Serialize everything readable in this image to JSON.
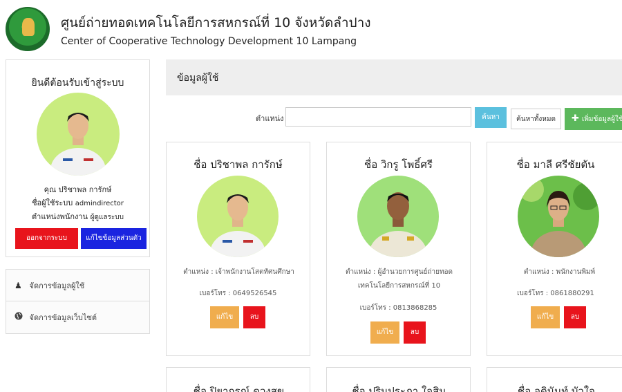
{
  "header": {
    "title_th": "ศูนย์ถ่ายทอดเทคโนโลยีการสหกรณ์ที่ 10 จังหวัดลำปาง",
    "title_en": "Center of Cooperative Technology Development 10 Lampang"
  },
  "profile": {
    "welcome": "ยินดีต้อนรับเข้าสู่ระบบ",
    "name_line": "คุณ ปริชาพล การักษ์",
    "username_label": "ชื่อผู้ใช้ระบบ",
    "username": "admindirector",
    "position_label": "ตำแหน่งพนักงาน",
    "position": "ผู้ดูแลระบบ",
    "logout_label": "ออกจากระบบ",
    "edit_self_label": "แก้ไขข้อมูลส่วนตัว"
  },
  "menu": {
    "items": [
      {
        "label": "จัดการข้อมูลผู้ใช้",
        "icon": "user-icon"
      },
      {
        "label": "จัดการข้อมูลเว็บไซต์",
        "icon": "globe-icon"
      }
    ]
  },
  "main": {
    "panel_title": "ข้อมูลผู้ใช้",
    "search_label": "ตำแหน่ง",
    "search_value": "",
    "search_button": "ค้นหา",
    "search_all_button": "ค้นหาทั้งหมด",
    "add_button": "เพิ่มข้อมูลผู้ใช้"
  },
  "users": [
    {
      "name": "ชื่อ ปริชาพล การักษ์",
      "position_line1": "ตำแหน่ง : เจ้าพนักงานโสตทัศนศึกษา",
      "position_line2": "",
      "phone": "เบอร์โทร : 0649526545",
      "edit_label": "แก้ไข",
      "delete_label": "ลบ"
    },
    {
      "name": "ชื่อ วิกรู โพธิ์ศรี",
      "position_line1": "ตำแหน่ง : ผู้อำนวยการศูนย์ถ่ายทอด",
      "position_line2": "เทคโนโลยีการสหกรณ์ที่ 10",
      "phone": "เบอร์โทร : 0813868285",
      "edit_label": "แก้ไข",
      "delete_label": "ลบ"
    },
    {
      "name": "ชื่อ มาลี ศรีชัยตัน",
      "position_line1": "ตำแหน่ง : พนักงานพิมพ์",
      "position_line2": "",
      "phone": "เบอร์โทร : 0861880291",
      "edit_label": "แก้ไข",
      "delete_label": "ลบ"
    }
  ],
  "users_next_row": [
    {
      "name": "ชื่อ ปิยากรณ์ ดวงสุข"
    },
    {
      "name": "ชื่อ ปรินประภา ใจสิน"
    },
    {
      "name": "ชื่อ อดินันท์ บัวใจ"
    }
  ],
  "colors": {
    "danger": "#e8141c",
    "primary": "#1a24e0",
    "info": "#5bc0de",
    "success": "#5cb85c",
    "warning": "#f0ad4e"
  }
}
